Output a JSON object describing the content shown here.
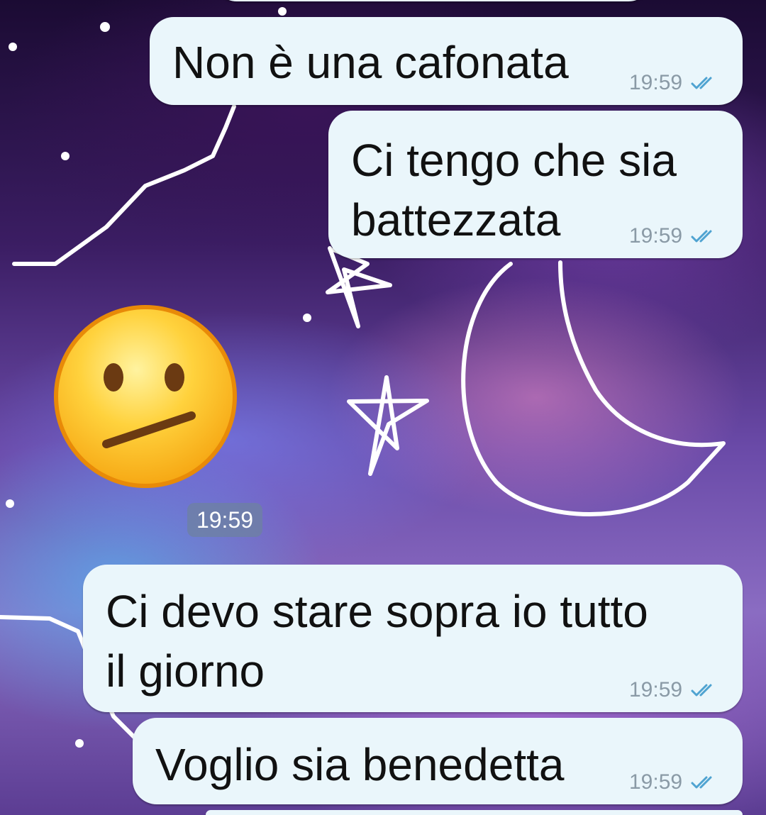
{
  "chat": {
    "messages": [
      {
        "text": "Non è una cafonata",
        "time": "19:59",
        "status": "read"
      },
      {
        "text": "Ci tengo che sia\nbattezzata",
        "time": "19:59",
        "status": "read"
      },
      {
        "text": "Ci devo stare sopra io tutto\nil giorno",
        "time": "19:59",
        "status": "read"
      },
      {
        "text": "Voglio sia benedetta",
        "time": "19:59",
        "status": "read"
      }
    ],
    "sticker": {
      "icon": "neutral-face-emoji-icon",
      "time": "19:59"
    }
  },
  "colors": {
    "bubble": "#eaf6fb",
    "read_ticks": "#4fa3d1",
    "timestamp": "#8a9aa6",
    "time_pill": "#6e82a0"
  }
}
